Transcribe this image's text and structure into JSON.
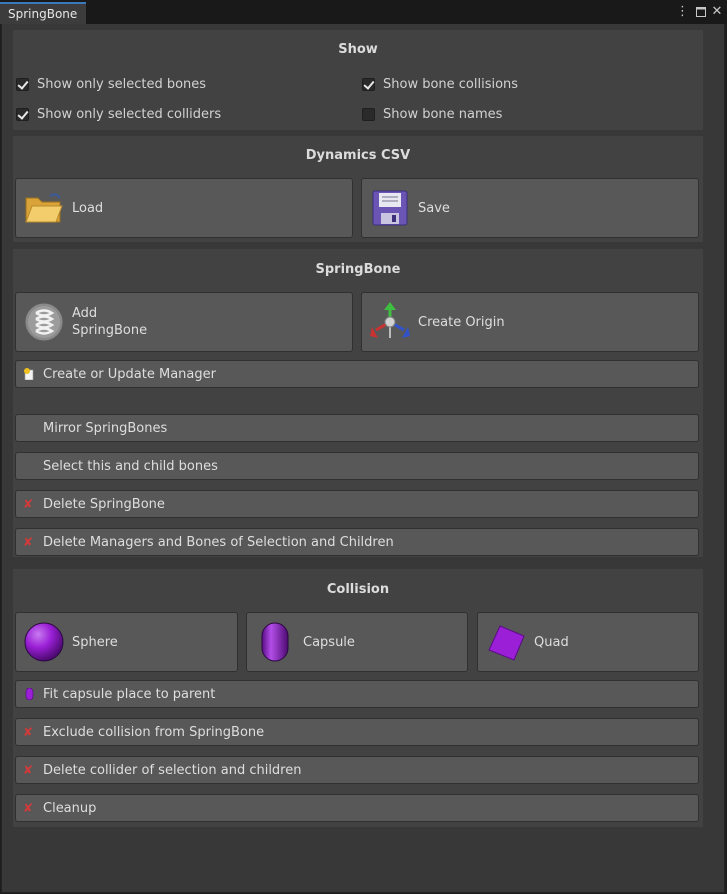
{
  "window": {
    "tab_title": "SpringBone",
    "menu_icon": "kebab-menu-icon",
    "maximize_icon": "maximize-icon",
    "close_icon": "close-icon"
  },
  "show": {
    "title": "Show",
    "options": [
      {
        "label": "Show only selected bones",
        "checked": true
      },
      {
        "label": "Show bone collisions",
        "checked": true
      },
      {
        "label": "Show only selected colliders",
        "checked": true
      },
      {
        "label": "Show bone names",
        "checked": false
      }
    ]
  },
  "dynamics": {
    "title": "Dynamics CSV",
    "load_label": "Load",
    "save_label": "Save",
    "load_icon": "folder-icon",
    "save_icon": "floppy-disk-icon"
  },
  "springbone": {
    "title": "SpringBone",
    "add_label": "Add\nSpringBone",
    "create_origin_label": "Create Origin",
    "create_manager_label": "Create or Update Manager",
    "mirror_label": "Mirror SpringBones",
    "select_children_label": "Select this and child bones",
    "delete_label": "Delete SpringBone",
    "delete_managers_label": "Delete Managers and Bones of Selection and Children"
  },
  "collision": {
    "title": "Collision",
    "sphere_label": "Sphere",
    "capsule_label": "Capsule",
    "quad_label": "Quad",
    "fit_capsule_label": "Fit capsule place to parent",
    "exclude_label": "Exclude collision from SpringBone",
    "delete_collider_label": "Delete collider of selection and children",
    "cleanup_label": "Cleanup"
  },
  "colors": {
    "accent_purple": "#9a1fd6",
    "delete_red": "#d23a3a",
    "tab_highlight": "#3a79bb"
  }
}
